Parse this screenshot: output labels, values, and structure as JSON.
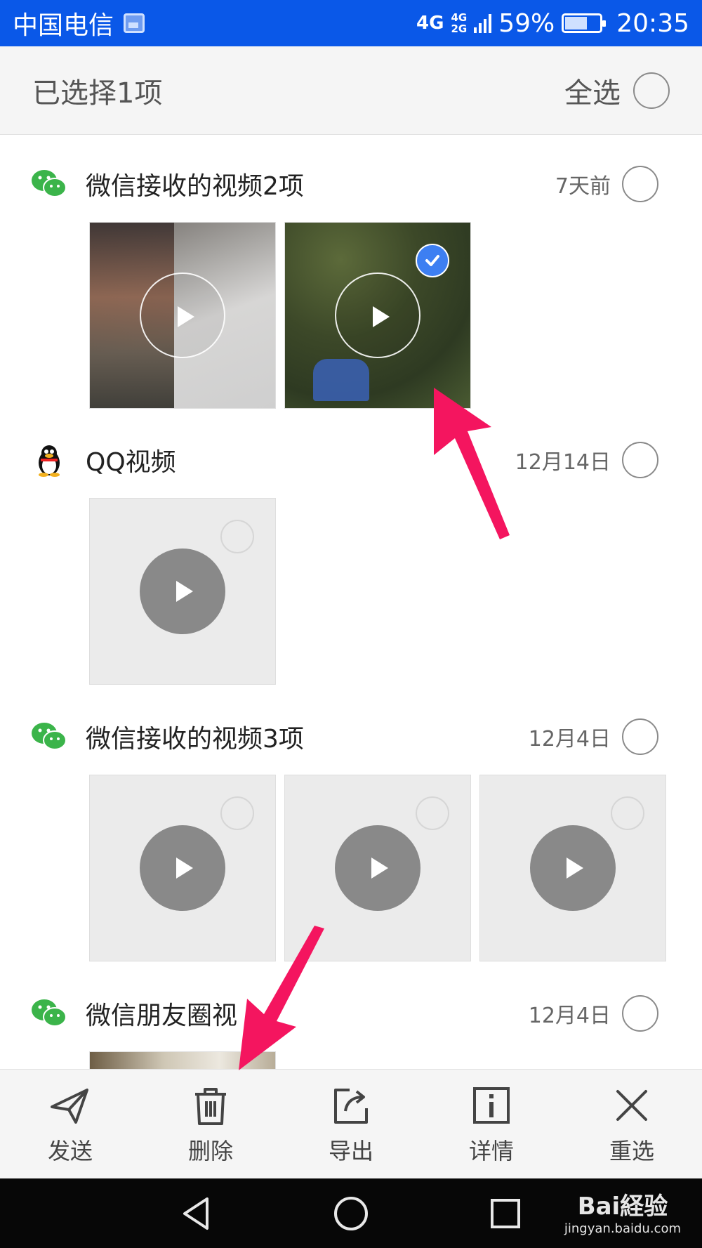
{
  "status_bar": {
    "carrier": "中国电信",
    "network_main": "4G",
    "network_secondary_top": "4G",
    "network_secondary_bottom": "2G",
    "battery": "59%",
    "battery_level": 0.59,
    "time": "20:35"
  },
  "selection_header": {
    "count_text": "已选择1项",
    "select_all_label": "全选"
  },
  "groups": [
    {
      "icon": "wechat-icon",
      "title": "微信接收的视频2项",
      "date": "7天前",
      "thumbnails": 2,
      "selected_thumbnail": 2
    },
    {
      "icon": "qq-penguin-icon",
      "title": "QQ视频",
      "date": "12月14日",
      "thumbnails": 1
    },
    {
      "icon": "wechat-icon",
      "title": "微信接收的视频3项",
      "date": "12月4日",
      "thumbnails": 3
    },
    {
      "icon": "wechat-icon",
      "title": "微信朋友圈视",
      "date": "12月4日",
      "thumbnails": 1
    }
  ],
  "toolbar": [
    {
      "icon": "send-icon",
      "label": "发送"
    },
    {
      "icon": "trash-icon",
      "label": "删除"
    },
    {
      "icon": "export-icon",
      "label": "导出"
    },
    {
      "icon": "info-icon",
      "label": "详情"
    },
    {
      "icon": "close-icon",
      "label": "重选"
    }
  ],
  "nav": [
    "back-icon",
    "home-icon",
    "recents-icon"
  ],
  "watermark": {
    "line1": "Bai経验",
    "line2": "jingyan.baidu.com"
  },
  "colors": {
    "status_bar": "#0a58e8",
    "accent_check": "#3d7ff2",
    "arrow": "#f4155f",
    "wechat": "#3bb44a"
  }
}
